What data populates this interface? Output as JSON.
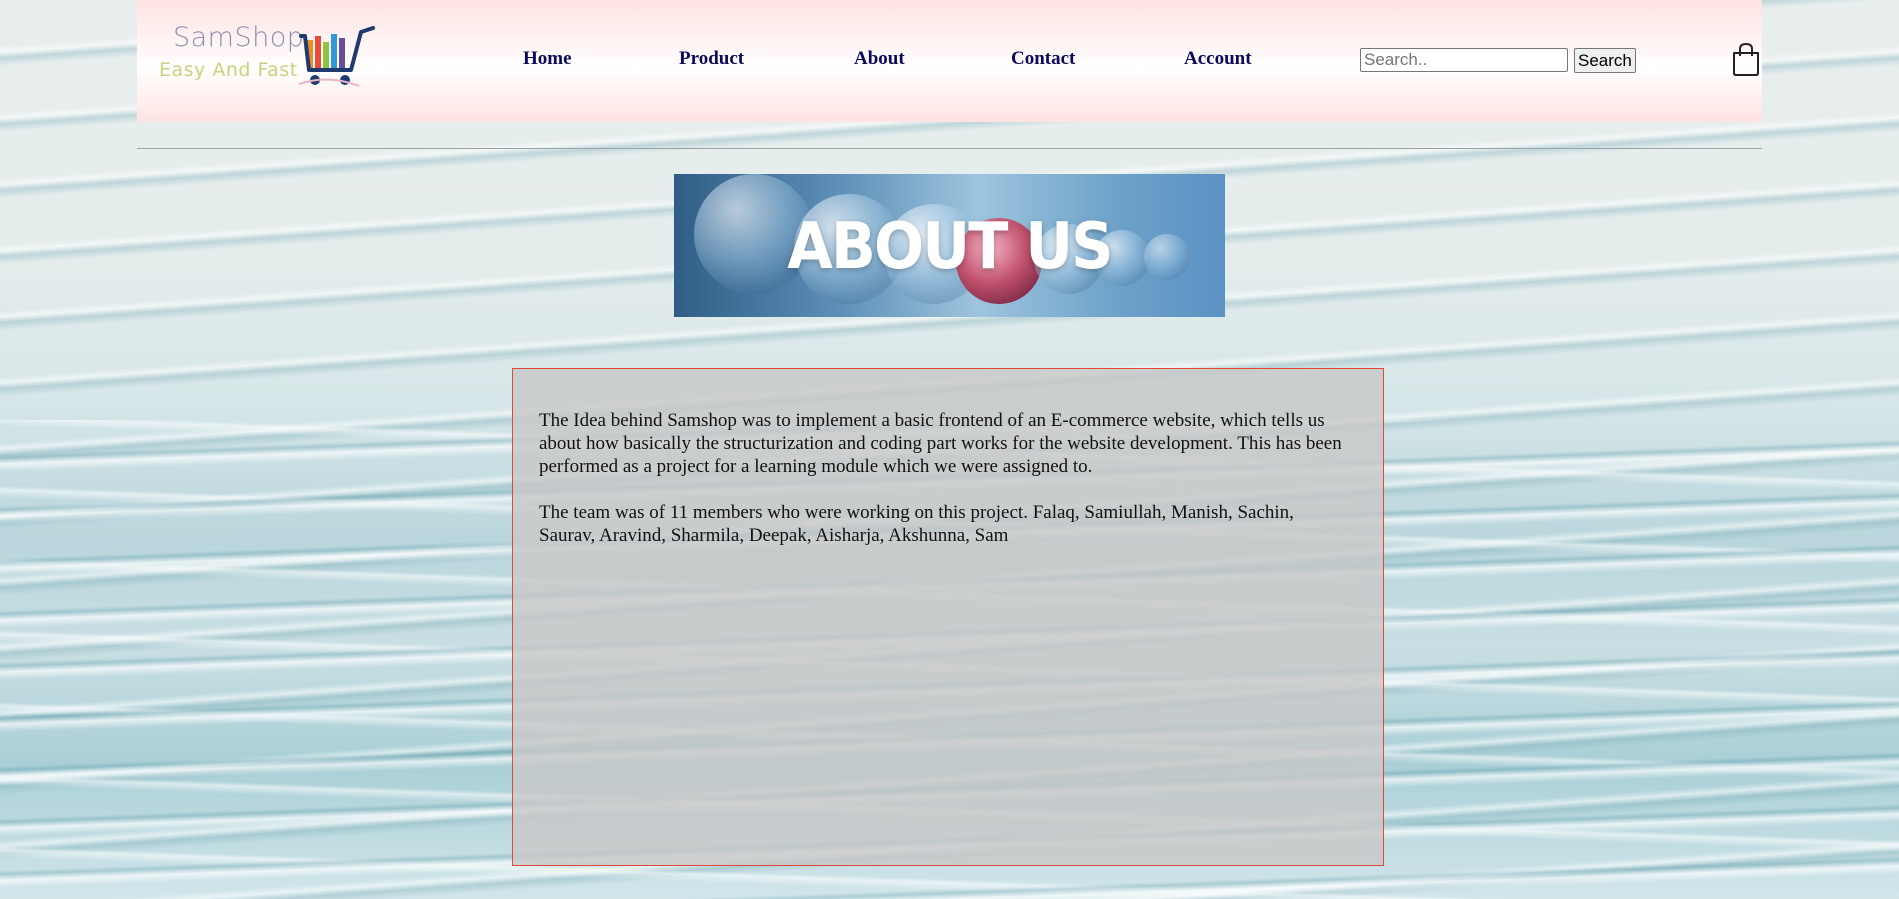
{
  "logo": {
    "brand": "SamShop",
    "tagline": "Easy And Fast",
    "icon": "shopping-cart-icon"
  },
  "nav": {
    "items": [
      {
        "label": "Home"
      },
      {
        "label": "Product"
      },
      {
        "label": "About"
      },
      {
        "label": "Contact"
      },
      {
        "label": "Account"
      }
    ]
  },
  "search": {
    "placeholder": "Search..",
    "value": "",
    "button_label": "Search"
  },
  "cart": {
    "icon": "shopping-bag-icon"
  },
  "banner": {
    "title": "ABOUT US"
  },
  "about": {
    "paragraphs": [
      "The Idea behind Samshop was to implement a basic frontend of an E-commerce website, which tells us about how basically the structurization and coding part works for the website development. This has been performed as a project for a learning module which we were assigned to.",
      "The team was of 11 members who were working on this project. Falaq, Samiullah, Manish, Sachin, Saurav, Aravind, Sharmila, Deepak, Aisharja, Akshunna, Sam"
    ]
  },
  "colors": {
    "nav_text": "#0a0a5c",
    "box_border": "#e0493a",
    "header_bg": "#ffe3e3",
    "logo_brand": "#8a8fb0",
    "logo_tagline": "#c9d27a"
  }
}
